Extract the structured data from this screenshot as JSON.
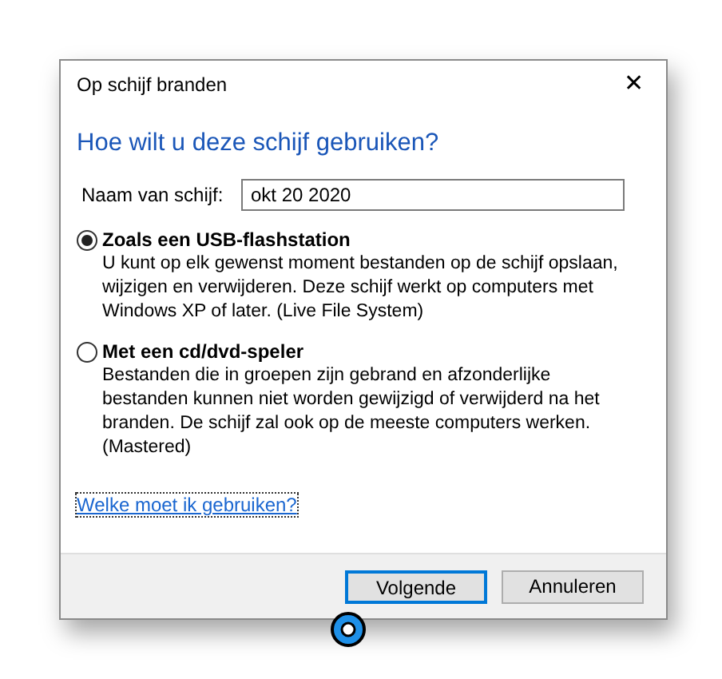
{
  "window": {
    "title": "Op schijf branden",
    "close": "✕"
  },
  "heading": "Hoe wilt u deze schijf gebruiken?",
  "name_field": {
    "label": "Naam van schijf:",
    "value": "okt 20 2020"
  },
  "options": [
    {
      "label": "Zoals een USB-flashstation",
      "selected": true,
      "description": "U kunt op elk gewenst moment bestanden op de schijf opslaan, wijzigen en verwijderen. Deze schijf werkt op computers met Windows XP of later. (Live File System)"
    },
    {
      "label": "Met een cd/dvd-speler",
      "selected": false,
      "description": "Bestanden die in groepen zijn gebrand en afzonderlijke bestanden kunnen niet worden gewijzigd of verwijderd na het branden. De schijf zal ook op de meeste computers werken. (Mastered)"
    }
  ],
  "help_link": "Welke moet ik gebruiken?",
  "buttons": [
    {
      "label": "Volgende",
      "default": true
    },
    {
      "label": "Annuleren",
      "default": false
    }
  ]
}
